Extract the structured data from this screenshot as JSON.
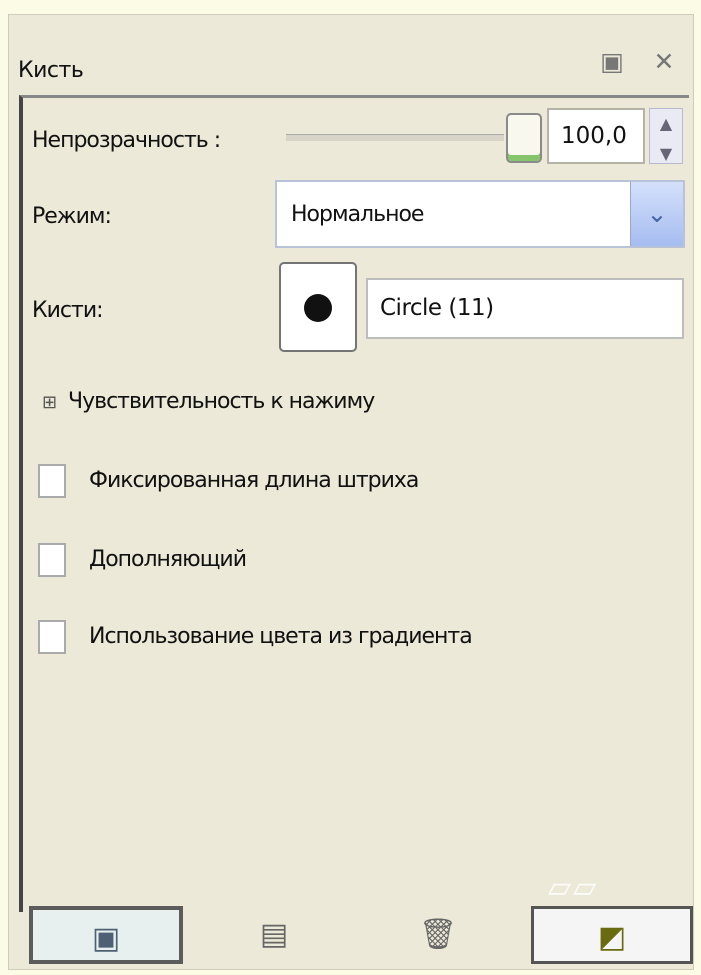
{
  "window": {
    "title": "Кисть"
  },
  "controls": {
    "opacity_label": "Непрозрачность :",
    "opacity_value": "100,0",
    "opacity_level_percent": 100,
    "mode_label": "Режим:",
    "mode_value": "Нормальное",
    "brush_label": "Кисти:",
    "brush_name": "Circle (11)"
  },
  "options": {
    "expander": "Чувствительность к нажиму",
    "checkboxes": [
      {
        "label": "Фиксированная длина штриха",
        "checked": false
      },
      {
        "label": "Дополняющий",
        "checked": false
      },
      {
        "label": "Использование цвета из градиента",
        "checked": false
      }
    ]
  },
  "icons": {
    "dock": "dock-icon",
    "close": "close-icon",
    "slider": "slider-handle-icon",
    "spin": "spin-arrows-icon",
    "dropdown": "chevron-down-icon",
    "expander": "expander-icon",
    "bottom_buttons": [
      "save-preset-icon",
      "restore-preset-icon",
      "delete-preset-icon",
      "reset-icon"
    ]
  },
  "colors": {
    "panel_bg": "#ece9d8",
    "dropdown_accent": "#a6bdf0",
    "slider_accent": "#87c56d"
  }
}
